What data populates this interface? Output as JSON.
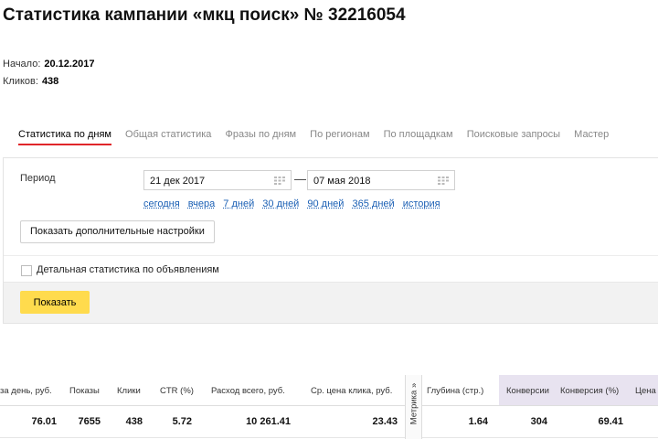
{
  "header": {
    "title": "Статистика кампании «мкц поиск» № 32216054",
    "start_label": "Начало:",
    "start_value": "20.12.2017",
    "clicks_label": "Кликов:",
    "clicks_value": "438"
  },
  "tabs": [
    {
      "label": "Статистика по дням",
      "active": true
    },
    {
      "label": "Общая статистика"
    },
    {
      "label": "Фразы по дням"
    },
    {
      "label": "По регионам"
    },
    {
      "label": "По площадкам"
    },
    {
      "label": "Поисковые запросы"
    },
    {
      "label": "Мастер"
    }
  ],
  "filters": {
    "period_label": "Период",
    "date_from": "21 дек 2017",
    "date_to": "07 мая 2018",
    "dash": "—",
    "quick_ranges": [
      "сегодня",
      "вчера",
      "7 дней",
      "30 дней",
      "90 дней",
      "365 дней",
      "история"
    ],
    "more_settings": "Показать дополнительные настройки",
    "detailed_label": "Детальная статистика по объявлениям",
    "show_button": "Показать"
  },
  "table": {
    "columns": [
      "за день, руб.",
      "Показы",
      "Клики",
      "CTR (%)",
      "Расход всего, руб.",
      "Ср. цена клика, руб.",
      "Глубина (стр.)",
      "Конверсии",
      "Конверсия (%)",
      "Цена"
    ],
    "row": [
      "76.01",
      "7655",
      "438",
      "5.72",
      "10 261.41",
      "23.43",
      "1.64",
      "304",
      "69.41",
      ""
    ],
    "metrika_label": "Метрика »"
  },
  "colors": {
    "accent_tab": "#e0262a",
    "show_button": "#ffdb4d",
    "link": "#1a5fb4",
    "metrika_cols_bg": "#e8e3f0"
  }
}
